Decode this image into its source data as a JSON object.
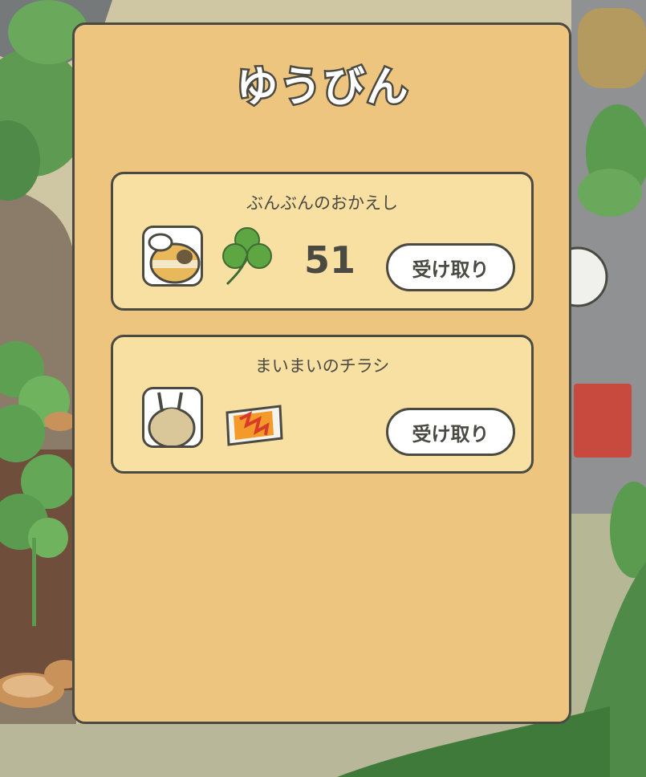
{
  "title": "ゆうびん",
  "colors": {
    "panel": "#eec57e",
    "card": "#f8dfa2",
    "border": "#4a4a42",
    "clover": "#5da642"
  },
  "mail": [
    {
      "sender": "ぶんぶんのおかえし",
      "sender_icon": "bee-icon",
      "item_icon": "clover-icon",
      "count": "51",
      "button": "受け取り"
    },
    {
      "sender": "まいまいのチラシ",
      "sender_icon": "snail-icon",
      "item_icon": "flyer-icon",
      "button": "受け取り"
    }
  ]
}
